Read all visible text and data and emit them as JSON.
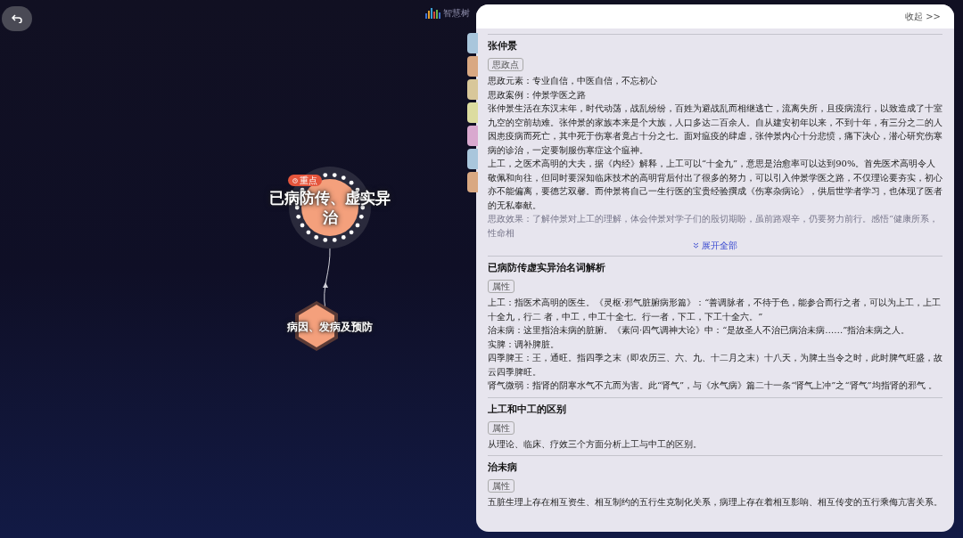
{
  "logo": {
    "text": "智慧树"
  },
  "graph": {
    "center_node": {
      "label": "已病防传、虚实异治",
      "badge": "重点"
    },
    "child_node": {
      "label": "病因、发病及预防"
    }
  },
  "side_tabs": [
    {
      "color": "#a9c6dc"
    },
    {
      "color": "#d9a882"
    },
    {
      "color": "#d8c79a"
    },
    {
      "color": "#dcdca0"
    },
    {
      "color": "#d9a9cf"
    },
    {
      "color": "#a9c6dc"
    },
    {
      "color": "#d9a882"
    }
  ],
  "panel": {
    "collapse_label": "收起 >>",
    "sections": [
      {
        "title": "张仲景",
        "tag": "思政点",
        "paragraphs": [
          {
            "text": "思政元素：专业自信，中医自信，不忘初心",
            "faded": false
          },
          {
            "text": "思政案例：仲景学医之路",
            "faded": false
          },
          {
            "text": "张仲景生活在东汉末年，时代动荡，战乱纷纷，百姓为避战乱而相继逃亡，流离失所，且疫病流行，以致造成了十室九空的空前劫难。张仲景的家族本来是个大族，人口多达二百余人。自从建安初年以来，不到十年，有三分之二的人因患疫病而死亡，其中死于伤寒者竟占十分之七。面对瘟疫的肆虐，张仲景内心十分悲愤，痛下决心，潜心研究伤寒病的诊治，一定要制服伤寒症这个瘟神。",
            "faded": false
          },
          {
            "text": "上工，之医术高明的大夫，据《内经》解释，上工可以“十全九”，意思是治愈率可以达到90%。首先医术高明令人敬佩和向往，但同时要深知临床技术的高明背后付出了很多的努力，可以引入仲景学医之路，不仅理论要夯实，初心亦不能偏离，要德艺双馨。而仲景将自己一生行医的宝贵经验撰成《伤寒杂病论》，供后世学者学习，也体现了医者的无私奉献。",
            "faded": false
          },
          {
            "text": "思政效果：了解仲景对上工的理解，体会仲景对学子们的殷切期盼，虽前路艰辛，仍要努力前行。感悟“健康所系，性命相",
            "faded": true
          }
        ],
        "expand_label": "展开全部"
      },
      {
        "title": "已病防传虚实异治名词解析",
        "tag": "属性",
        "paragraphs": [
          {
            "text": "上工：指医术高明的医生。《灵枢·邪气脏腑病形篇》：“善调脉者，不待于色，能参合而行之者，可以为上工，上工十全九，行二 者，中工，中工十全七。行一者，下工，下工十全六。”",
            "faded": false
          },
          {
            "text": "治未病：这里指治未病的脏腑。《素问·四气调神大论》中：“是故圣人不治已病治未病……”指治未病之人。",
            "faded": false
          },
          {
            "text": "实脾：调补脾脏。",
            "faded": false
          },
          {
            "text": "四季脾王：王，通旺。指四季之末（即农历三、六、九、十二月之末）十八天，为脾土当令之时，此时脾气旺盛，故云四季脾旺。",
            "faded": false
          },
          {
            "text": "肾气微弱：指肾的阴寒水气不亢而为害。此“肾气”，与《水气病》篇二十一条“肾气上冲”之“肾气”均指肾的邪气 。",
            "faded": false
          }
        ]
      },
      {
        "title": "上工和中工的区别",
        "tag": "属性",
        "paragraphs": [
          {
            "text": "从理论、临床、疗效三个方面分析上工与中工的区别。",
            "faded": false
          }
        ]
      },
      {
        "title": "治未病",
        "tag": "属性",
        "paragraphs": [
          {
            "text": "五脏生理上存在相互资生、相互制约的五行生克制化关系，病理上存在着相互影响、相互传变的五行乘侮亢害关系。",
            "faded": false
          }
        ]
      }
    ]
  }
}
